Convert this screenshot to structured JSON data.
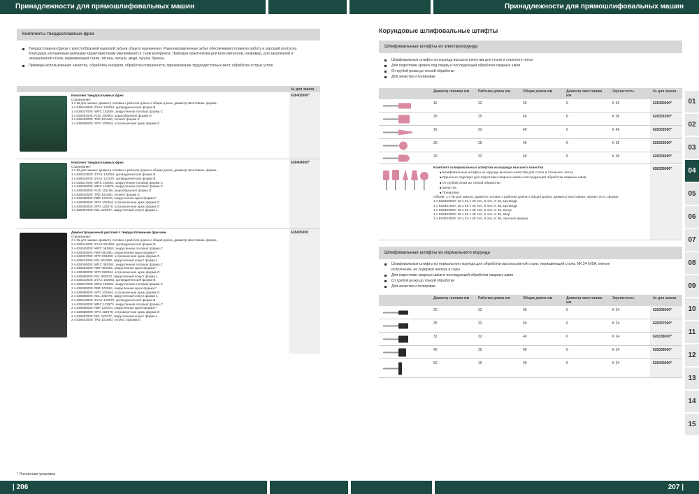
{
  "header": {
    "left_title": "Принадлежности для прямошлифовальных машин",
    "right_title": "Принадлежности для прямошлифовальных машин"
  },
  "footer": {
    "left_page": "| 206",
    "right_page": "207 |",
    "footnote": "* Розничная упаковка"
  },
  "left": {
    "section_title": "Комплекты твердосплавных фрез",
    "intro": [
      "Твердосплавная фреза с крестообразной нарезкой зубьев общего назначения. Разнонаправленные зубья обеспечивают плавную работу и хороший контроль. Благодаря улучшенным режущим характеристикам увеличивается съем материала. Пригодна практически для всех металлов, например, для закаленной и незакаленной стали, нержавеющей стали, титана, латуни, меди, чугуна, бронзы.",
      "Примеры использования: зачистка, обработка контуров, обработка поверхности, фрезерование труднодоступных мест, обработка острых углов"
    ],
    "table_header": "№ для заказа",
    "rows": [
      {
        "title": "Комплект твердосплавных фрез",
        "lines": [
          "Содержание:",
          "1 х № для заказа: диаметр головки x рабочая длина x общая длина, диаметр хвостовика, форма",
          "1 x 628343000: ZYAS 102064, цилиндрическая/ форма B",
          "1 x 628347000: WRC 102064, закругленная головка/ форма C",
          "1 x 628351000: KUD 100854, шарообразная/ форма D",
          "1 x 628402000: TRE 101660, эллипс/ форма E",
          "1 x 628359000: SPG 102064, остроконечная арка/ форма G"
        ],
        "article": "628403000*"
      },
      {
        "title": "Комплект твердосплавных фрез",
        "lines": [
          "Содержание:",
          "1 х № для заказа: диаметр головки x рабочая длина x общая длина, диаметр хвостовика, форма",
          "1 x 628343000: ZYAS 102064, цилиндрическая/ форма B",
          "1 x 628344000: ZYAS 122570, цилиндрическая/ форма B",
          "1 x 628347000: WRC 102064, закругленная головка/ форма C",
          "1 x 628348000: WRC 122570, закругленная головка/ форма C",
          "1 x 628352000: KUD 121158, шарообразная/ форма D",
          "1 x 628402000: TRE 101660, эллипс/ форма E",
          "1 x 628356000: RBF 122570, закругленная арка/ форма F",
          "1 x 628359000: SPG 102064, остроконечная арка/ форма G",
          "1 x 628360000: SPG 122570, остроконечная арка/ форма G",
          "1 x 628367000: KEL 123277, закругленный конус/ форма L"
        ],
        "article": "628404000*"
      },
      {
        "title": "Демонстрационный дисплей с твердосплавными фрезами",
        "lines": [
          "Содержание:",
          "2 х № для заказа: диаметр головки x рабочая длина x общая длина, диаметр хвостовика, форма",
          "2 x 628341000: ZYAS 061850, цилиндрическая/ форма B",
          "2 x 628345000: WRC 061850, закругленная головка/ форма C",
          "2 x 628353000: RBF 061850, закругленная арка/ форма F",
          "2 x 628357000: SPG 061850, остроконечная арка/ форма G",
          "2 x 628401000: KEL 061850, закругленный конус/ форма L",
          "2 x 628346000: WRC 082064, закругленная головка/ форма C",
          "2 x 628354000: RBF 082065, закругленная арка/ форма F",
          "2 x 628358000: SPG 082064, остроконечная арка/ форма G",
          "2 x 628365000: KEL 082570, закругленный конус/ форма L",
          "2 x 628343000: ZYAS 102064, цилиндрическая/ форма B",
          "2 x 628347000: WRC 102064, закругленная головка/ форма C",
          "2 x 628355000: RBF 102064, закругленная арка/ форма F",
          "2 x 628359000: SPG 102064, остроконечная арка/ форма G",
          "2 x 628366000: KEL 103076, закругленный конус/ форма L",
          "2 x 628344000: ZYAS 122570, цилиндрическая/ форма B",
          "1 x 628348000: WRC 122570, закругленная головка/ форма C",
          "2 x 628356000: RBF 122570, закругленная арка/ форма F",
          "2 x 628360000: SPG 122570, остроконечная арка/ форма G",
          "2 x 628367000: KEL 123277, закругленный конус/ форма L",
          "2 x 628402000: TRE 101660, эллипс / форма E"
        ],
        "article": "628405000"
      }
    ]
  },
  "right": {
    "title": "Корундовые шлифовальные штифты",
    "sec1": {
      "bar": "Шлифовальные штифты из электрокорунда",
      "bullets": [
        "Шлифовальные штифты из корунда высшего качества для стали и стального литья",
        "Для подготовки кромок под сварку и последующей обработки сварных швов",
        "От грубой резки до тонкой обработки",
        "Для зачистки и полировки"
      ],
      "cols": [
        "Диаметр головки мм",
        "Рабочая длина мм",
        "Общая длина мм",
        "Диаметр хвостовика мм",
        "Зернистость",
        "№ для заказа"
      ],
      "rows": [
        [
          "16",
          "32",
          "40",
          "6",
          "K 46",
          "628330000*"
        ],
        [
          "25",
          "25",
          "40",
          "6",
          "K 36",
          "628331000*"
        ],
        [
          "16",
          "32",
          "40",
          "6",
          "K 46",
          "628332000*"
        ],
        [
          "25",
          "25",
          "40",
          "6",
          "K 36",
          "628333000*"
        ],
        [
          "20",
          "32",
          "40",
          "6",
          "K 36",
          "628334000*"
        ]
      ],
      "kit": {
        "title": "Комплект шлифовальных штифтов из корунда высшего качества",
        "bullets": [
          "Шлифовальные штифты из корунда высшего качества для стали и стального литья",
          "Идеально подходит для подготовки сварных швов и последующей обработки сварных швов",
          "От грубой резки до тонкой обработки",
          "Зачистка",
          "Полировка"
        ],
        "lines": [
          "Объем: 1 х № для заказа: диаметр головки x рабочая длина x общая длина, диаметр хвостовика, зернистость, форма",
          "1 x 628330000: 16 x 32 x 40 mm, 6 mm, K 46, Цилиндр",
          "1 x 628331000: 25 x 25 x 40 mm, 6 mm, K 36, Цилиндр",
          "1 x 628332000: 16 x 32 x 40 mm, 6 mm, K 46, Конус",
          "1 x 628333000: 25 x 25 x 40 mm, 6 mm, K 36, Шар",
          "1 x 628334000: 20 x 32 x 40 mm, 6 mm, K 36, Арочная форма"
        ],
        "article": "628335000*"
      }
    },
    "sec2": {
      "bar": "Шлифовальные штифты из нормального корунда",
      "bullets": [
        "Шлифовальные штифты из нормального корунда для обработки высокосортной стали, нержавеющей стали, NK 24 N BA, мягкое исполнение, не содержат железа и серы",
        "Для подготовки сварных швов и последующей обработки сварных швов",
        "От грубой резки до тонкой обработки",
        "Для зачистки и полировки"
      ],
      "rows": [
        [
          "20",
          "32",
          "40",
          "6",
          "K 24",
          "628336000*"
        ],
        [
          "25",
          "32",
          "40",
          "6",
          "K 24",
          "628337000*"
        ],
        [
          "32",
          "32",
          "40",
          "6",
          "K 24",
          "628338000*"
        ],
        [
          "40",
          "20",
          "40",
          "6",
          "K 24",
          "628339000*"
        ],
        [
          "50",
          "10",
          "40",
          "6",
          "K 24",
          "628340000*"
        ]
      ]
    }
  },
  "tabs": [
    "01",
    "02",
    "03",
    "04",
    "05",
    "06",
    "07",
    "08",
    "09",
    "10",
    "11",
    "12",
    "13",
    "14",
    "15"
  ],
  "active_tab": "04",
  "colors": {
    "brand": "#1b4a42",
    "bar": "#d6d8d8",
    "pink_pin": "#d98aa0",
    "dark_pin": "#2a2a2a"
  }
}
